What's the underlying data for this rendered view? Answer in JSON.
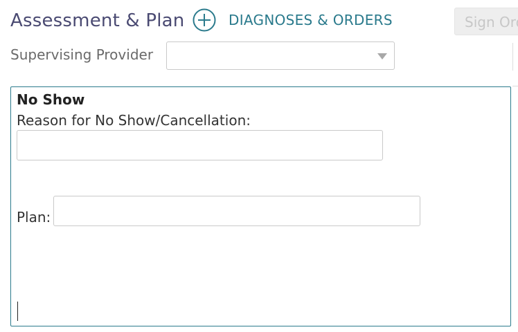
{
  "header": {
    "title": "Assessment & Plan",
    "add_label": "DIAGNOSES & ORDERS",
    "add_icon": "plus-circle-icon",
    "sign_label": "Sign Orders"
  },
  "supervising": {
    "label": "Supervising Provider",
    "selected": "",
    "dropdown_icon": "chevron-down-icon"
  },
  "note": {
    "heading": "No Show",
    "reason_label": "Reason for No Show/Cancellation:",
    "reason_value": "",
    "plan_label": "Plan:",
    "plan_value": ""
  },
  "colors": {
    "accent": "#2a7a8c",
    "title": "#4a4a72"
  }
}
